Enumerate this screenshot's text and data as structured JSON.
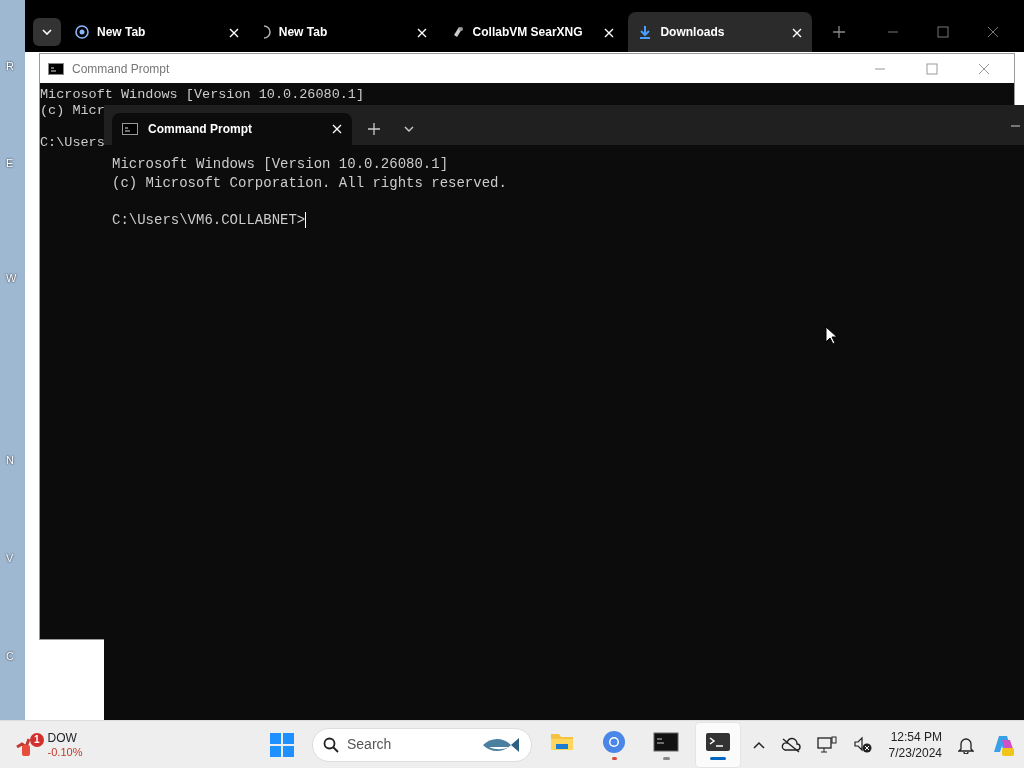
{
  "desktop_labels": [
    "R",
    "E",
    "W",
    "N",
    "V",
    "C"
  ],
  "browser": {
    "tabs": [
      {
        "label": "New Tab",
        "selected": false,
        "kind": "globe"
      },
      {
        "label": "New Tab",
        "selected": false,
        "kind": "loading"
      },
      {
        "label": "CollabVM SearXNG",
        "selected": false,
        "kind": "site"
      },
      {
        "label": "Downloads",
        "selected": true,
        "kind": "download"
      }
    ]
  },
  "back_console": {
    "title": "Command Prompt",
    "lines": [
      "Microsoft Windows [Version 10.0.26080.1]",
      "(c) Micr"
    ],
    "prompt": "C:\\Users"
  },
  "terminal": {
    "tab": {
      "title": "Command Prompt",
      "selected": true
    },
    "lines": [
      "Microsoft Windows [Version 10.0.26080.1]",
      "(c) Microsoft Corporation. All rights reserved."
    ],
    "prompt": "C:\\Users\\VM6.COLLABNET>"
  },
  "taskbar": {
    "widget": {
      "badge": "1",
      "name": "DOW",
      "change": "-0.10%"
    },
    "search": {
      "placeholder": "Search"
    },
    "apps": [
      {
        "kind": "explorer",
        "running": false,
        "attention": false,
        "selected": false
      },
      {
        "kind": "chrome",
        "running": true,
        "attention": true,
        "selected": false
      },
      {
        "kind": "cmd",
        "running": true,
        "attention": false,
        "selected": false
      },
      {
        "kind": "terminal",
        "running": true,
        "attention": false,
        "selected": true
      }
    ],
    "clock": {
      "time": "12:54 PM",
      "date": "7/23/2024"
    }
  }
}
